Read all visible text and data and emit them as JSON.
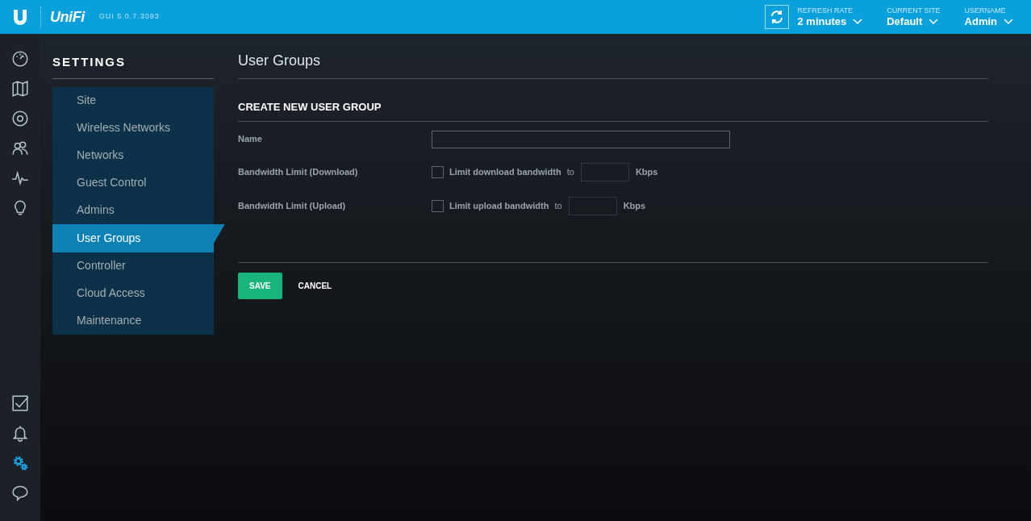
{
  "header": {
    "brand": "UniFi",
    "version": "GUI 5.0.7.3093",
    "refresh_rate": {
      "label": "REFRESH RATE",
      "value": "2 minutes"
    },
    "current_site": {
      "label": "CURRENT SITE",
      "value": "Default"
    },
    "username": {
      "label": "USERNAME",
      "value": "Admin"
    }
  },
  "rail": {
    "top": [
      {
        "kind": "dashboard",
        "selected": false
      },
      {
        "kind": "map",
        "selected": false
      },
      {
        "kind": "devices",
        "selected": false
      },
      {
        "kind": "clients",
        "selected": false
      },
      {
        "kind": "statistics",
        "selected": false
      },
      {
        "kind": "insights",
        "selected": false
      }
    ],
    "bottom": [
      {
        "kind": "tasks",
        "selected": false
      },
      {
        "kind": "alerts",
        "selected": false
      },
      {
        "kind": "settings",
        "selected": true
      },
      {
        "kind": "chat",
        "selected": false
      }
    ]
  },
  "settings": {
    "title": "SETTINGS",
    "items": [
      {
        "label": "Site",
        "selected": false
      },
      {
        "label": "Wireless Networks",
        "selected": false
      },
      {
        "label": "Networks",
        "selected": false
      },
      {
        "label": "Guest Control",
        "selected": false
      },
      {
        "label": "Admins",
        "selected": false
      },
      {
        "label": "User Groups",
        "selected": true
      },
      {
        "label": "Controller",
        "selected": false
      },
      {
        "label": "Cloud Access",
        "selected": false
      },
      {
        "label": "Maintenance",
        "selected": false
      }
    ]
  },
  "page": {
    "title": "User Groups",
    "section": "CREATE NEW USER GROUP",
    "name_label": "Name",
    "limits": [
      {
        "label": "Bandwidth Limit (Download)",
        "checkbox_label": "Limit download bandwidth",
        "to": "to",
        "unit": "Kbps",
        "checked": false
      },
      {
        "label": "Bandwidth Limit (Upload)",
        "checkbox_label": "Limit upload bandwidth",
        "to": "to",
        "unit": "Kbps",
        "checked": false
      }
    ],
    "buttons": {
      "save": "SAVE",
      "cancel": "CANCEL"
    }
  }
}
